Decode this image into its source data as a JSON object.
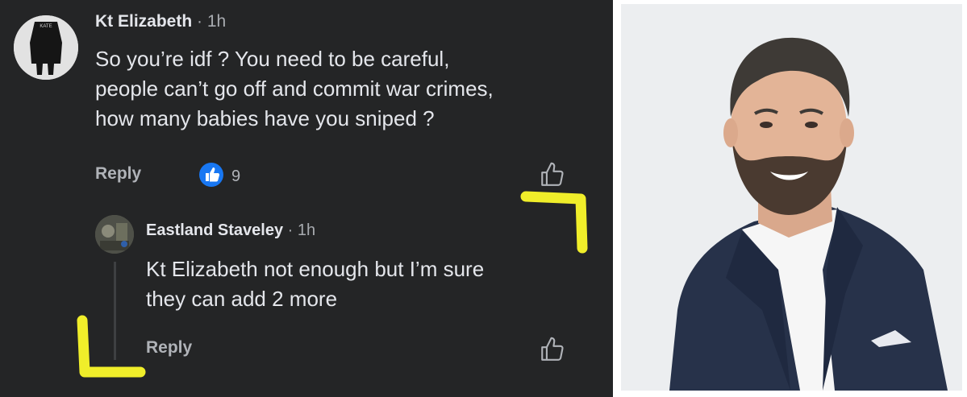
{
  "comment1": {
    "author": "Kt Elizabeth",
    "time": "· 1h",
    "lines": [
      "So you’re idf ? You need to be careful,",
      "people can’t go off and commit war crimes,",
      "how many babies have you sniped ?"
    ],
    "reply_label": "Reply",
    "reaction_count": "9",
    "avatar_text": "KATE"
  },
  "comment2": {
    "author": "Eastland Staveley",
    "time": "· 1h",
    "lines": [
      "Kt Elizabeth not enough but I’m sure",
      "they can add 2 more"
    ],
    "reply_label": "Reply"
  },
  "colors": {
    "panel_bg": "#242526",
    "text": "#e4e6eb",
    "meta": "#b0b3b8",
    "like_blue": "#1877f2",
    "highlight": "#f0ee2a"
  },
  "icons": [
    "like-reaction-icon",
    "thumbs-up-icon"
  ]
}
